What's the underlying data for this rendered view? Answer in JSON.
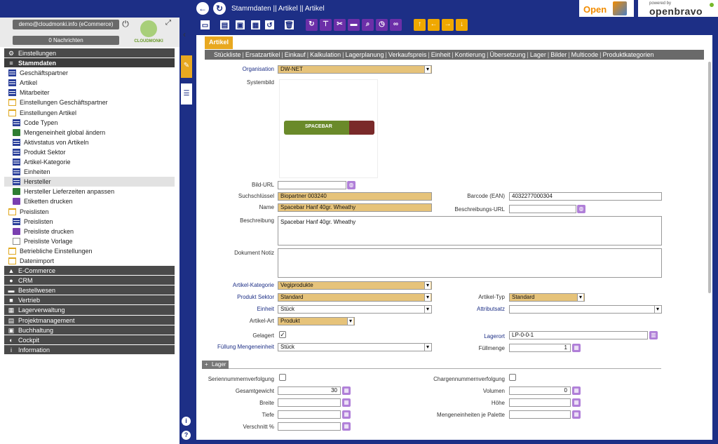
{
  "header": {
    "breadcrumb": "Stammdaten || Artikel || Artikel",
    "logo_ob3": "Open",
    "logo_pb_top": "powered by",
    "logo_pb": "openbravo"
  },
  "user": {
    "label": "demo@cloudmonki.info (eCommerce)",
    "notifications": "0  Nachrichten",
    "brand": "CLOUDMONKI"
  },
  "nav": [
    {
      "label": "Einstellungen",
      "type": "sec",
      "icon": "gear-icon"
    },
    {
      "label": "Stammdaten",
      "type": "sec-open",
      "icon": "menu-icon"
    },
    {
      "label": "Geschäftspartner",
      "type": "l1",
      "icon": "list"
    },
    {
      "label": "Artikel",
      "type": "l1",
      "icon": "list"
    },
    {
      "label": "Mitarbeiter",
      "type": "l1",
      "icon": "list"
    },
    {
      "label": "Einstellungen Geschäftspartner",
      "type": "l1",
      "icon": "folder"
    },
    {
      "label": "Einstellungen Artikel",
      "type": "l1",
      "icon": "folder"
    },
    {
      "label": "Code Typen",
      "type": "l2",
      "icon": "list"
    },
    {
      "label": "Mengeneinheit global ändern",
      "type": "l2",
      "icon": "proc"
    },
    {
      "label": "Aktivstatus von Artikeln",
      "type": "l2",
      "icon": "list"
    },
    {
      "label": "Produkt Sektor",
      "type": "l2",
      "icon": "list"
    },
    {
      "label": "Artikel-Kategorie",
      "type": "l2",
      "icon": "list"
    },
    {
      "label": "Einheiten",
      "type": "l2",
      "icon": "list"
    },
    {
      "label": "Hersteller",
      "type": "l2",
      "icon": "list",
      "selected": true
    },
    {
      "label": "Hersteller Lieferzeiten anpassen",
      "type": "l2",
      "icon": "proc"
    },
    {
      "label": "Etiketten drucken",
      "type": "l2",
      "icon": "rep"
    },
    {
      "label": "Preislisten",
      "type": "l1",
      "icon": "folder"
    },
    {
      "label": "Preislisten",
      "type": "l2",
      "icon": "list"
    },
    {
      "label": "Preisliste drucken",
      "type": "l2",
      "icon": "rep"
    },
    {
      "label": "Preisliste Vorlage",
      "type": "l2",
      "icon": "form"
    },
    {
      "label": "Betriebliche Einstellungen",
      "type": "l1",
      "icon": "folder"
    },
    {
      "label": "Datenimport",
      "type": "l1",
      "icon": "folder"
    },
    {
      "label": "E-Commerce",
      "type": "sec",
      "icon": "bag-icon"
    },
    {
      "label": "CRM",
      "type": "sec",
      "icon": "chat-icon"
    },
    {
      "label": "Bestellwesen",
      "type": "sec",
      "icon": "cart-icon"
    },
    {
      "label": "Vertrieb",
      "type": "sec",
      "icon": "truck-icon"
    },
    {
      "label": "Lagerverwaltung",
      "type": "sec",
      "icon": "warehouse-icon"
    },
    {
      "label": "Projektmanagement",
      "type": "sec",
      "icon": "project-icon"
    },
    {
      "label": "Buchhaltung",
      "type": "sec",
      "icon": "money-icon"
    },
    {
      "label": "Cockpit",
      "type": "sec",
      "icon": "cockpit-icon"
    },
    {
      "label": "Information",
      "type": "sec",
      "icon": "info-icon"
    }
  ],
  "window": {
    "tab": "Artikel",
    "subtabs": [
      "Stückliste",
      "Ersatzartikel",
      "Einkauf",
      "Kalkulation",
      "Lagerplanung",
      "Verkaufspreis",
      "Einheit",
      "Kontierung",
      "Übersetzung",
      "Lager",
      "Bilder",
      "Multicode",
      "Produktkategorien"
    ]
  },
  "form": {
    "organisation": {
      "label": "Organisation",
      "value": "DW-NET"
    },
    "systembild": {
      "label": "Systembild",
      "image_text": "SPACEBAR"
    },
    "bild_url": {
      "label": "Bild-URL",
      "value": ""
    },
    "suchschluessel": {
      "label": "Suchschlüssel",
      "value": "Biopartner 003240"
    },
    "barcode": {
      "label": "Barcode (EAN)",
      "value": "4032277000304"
    },
    "name": {
      "label": "Name",
      "value": "Spacebar Hanf 40gr. Wheathy"
    },
    "beschreibungs_url": {
      "label": "Beschreibungs-URL",
      "value": ""
    },
    "beschreibung": {
      "label": "Beschreibung",
      "value": "Spacebar Hanf 40gr. Wheathy"
    },
    "dokument_notiz": {
      "label": "Dokument Notiz",
      "value": ""
    },
    "artikel_kategorie": {
      "label": "Artikel-Kategorie",
      "value": "Vegiprodukte"
    },
    "produkt_sektor": {
      "label": "Produkt Sektor",
      "value": "Standard"
    },
    "artikel_typ": {
      "label": "Artikel-Typ",
      "value": "Standard"
    },
    "einheit": {
      "label": "Einheit",
      "value": "Stück"
    },
    "attributsatz": {
      "label": "Attributsatz",
      "value": ""
    },
    "artikel_art": {
      "label": "Artikel-Art",
      "value": "Produkt"
    },
    "gelagert": {
      "label": "Gelagert",
      "checked": true
    },
    "lagerort": {
      "label": "Lagerort",
      "value": "LP-0-0-1"
    },
    "fuellung": {
      "label": "Füllung Mengeneinheit",
      "value": "Stück"
    },
    "fuellmenge": {
      "label": "Füllmenge",
      "value": "1"
    },
    "section_lager": "Lager",
    "seriennummer": {
      "label": "Seriennummernverfolgung"
    },
    "chargennummer": {
      "label": "Chargennummernverfolgung"
    },
    "gesamtgewicht": {
      "label": "Gesamtgewicht",
      "value": "30"
    },
    "volumen": {
      "label": "Volumen",
      "value": "0"
    },
    "breite": {
      "label": "Breite",
      "value": ""
    },
    "hoehe": {
      "label": "Höhe",
      "value": ""
    },
    "tiefe": {
      "label": "Tiefe",
      "value": ""
    },
    "mengeneinheiten_palette": {
      "label": "Mengeneinheiten je Palette",
      "value": ""
    },
    "verschnitt": {
      "label": "Verschnitt %",
      "value": ""
    }
  }
}
